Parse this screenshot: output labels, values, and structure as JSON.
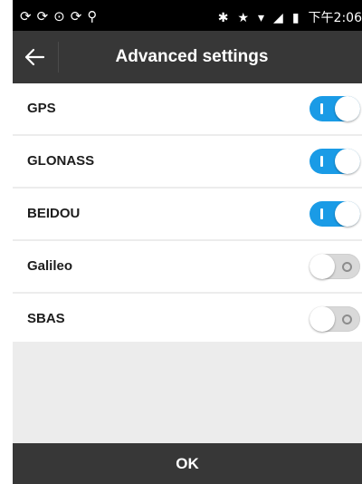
{
  "status_bar": {
    "left_icons": "✵ ✵ Ⓒ ✵ ☘",
    "right_icons": [
      "bluetooth-icon",
      "star-icon",
      "wifi-icon",
      "signal-icon",
      "battery-icon"
    ],
    "time": "下午2:06"
  },
  "app_bar": {
    "title": "Advanced settings"
  },
  "settings": [
    {
      "label": "GPS",
      "on": true
    },
    {
      "label": "GLONASS",
      "on": true
    },
    {
      "label": "BEIDOU",
      "on": true
    },
    {
      "label": "Galileo",
      "on": false
    },
    {
      "label": "SBAS",
      "on": false
    }
  ],
  "footer": {
    "ok_label": "OK"
  },
  "colors": {
    "accent": "#1a9be6",
    "bar": "#373737"
  }
}
